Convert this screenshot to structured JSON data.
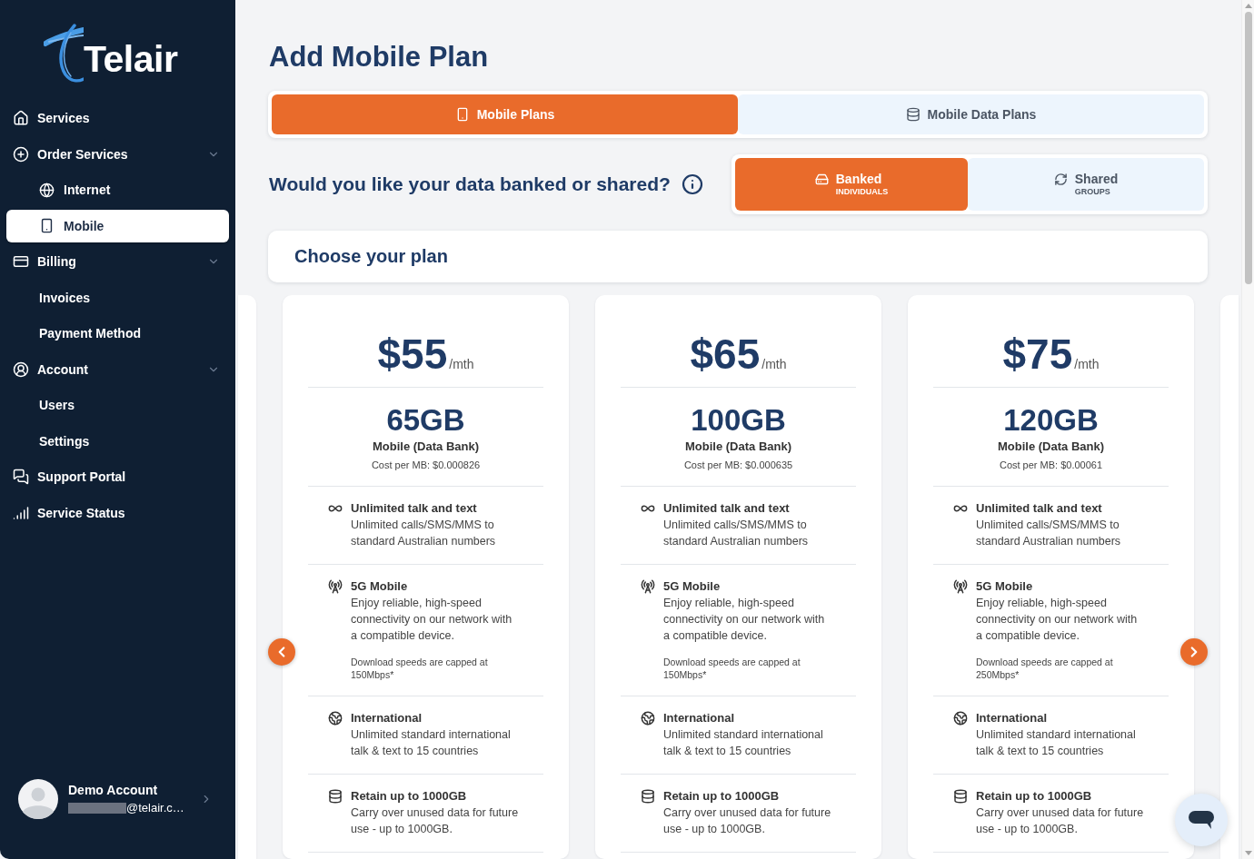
{
  "sidebar": {
    "logo": "Telair",
    "nav": [
      {
        "label": "Services",
        "selected": false
      },
      {
        "label": "Order Services",
        "selected": false,
        "expanded": true,
        "children": [
          {
            "label": "Internet",
            "selected": false
          },
          {
            "label": "Mobile",
            "selected": true
          }
        ]
      },
      {
        "label": "Billing",
        "selected": false,
        "expanded": true,
        "children": [
          {
            "label": "Invoices",
            "selected": false
          },
          {
            "label": "Payment Method",
            "selected": false
          }
        ]
      },
      {
        "label": "Account",
        "selected": false,
        "expanded": true,
        "children": [
          {
            "label": "Users",
            "selected": false
          },
          {
            "label": "Settings",
            "selected": false
          }
        ]
      },
      {
        "label": "Support Portal",
        "selected": false
      },
      {
        "label": "Service Status",
        "selected": false
      }
    ],
    "user": {
      "name": "Demo Account",
      "email": "@telair.c…"
    }
  },
  "page": {
    "title": "Add Mobile Plan"
  },
  "tabs": [
    {
      "label": "Mobile Plans",
      "selected": true
    },
    {
      "label": "Mobile Data Plans",
      "selected": false
    }
  ],
  "data_mode": {
    "question": "Would you like your data banked or shared?",
    "options": [
      {
        "label": "Banked",
        "sublabel": "INDIVIDUALS",
        "selected": true
      },
      {
        "label": "Shared",
        "sublabel": "GROUPS",
        "selected": false
      }
    ]
  },
  "plans_section": {
    "title": "Choose your plan",
    "plans": [
      {
        "price": "$55",
        "period": "/mth",
        "data": "65GB",
        "type": "Mobile (Data Bank)",
        "cost_per_mb": "Cost per MB: $0.000826",
        "features": [
          {
            "title": "Unlimited talk and text",
            "description": "Unlimited calls/SMS/MMS to standard Australian numbers"
          },
          {
            "title": "5G Mobile",
            "description": "Enjoy reliable, high-speed connectivity on our network with a compatible device.",
            "note": "Download speeds are capped at 150Mbps*"
          },
          {
            "title": "International",
            "description": "Unlimited standard international talk & text to 15 countries"
          },
          {
            "title": "Retain up to 1000GB",
            "description": "Carry over unused data for future use - up to 1000GB."
          }
        ]
      },
      {
        "price": "$65",
        "period": "/mth",
        "data": "100GB",
        "type": "Mobile (Data Bank)",
        "cost_per_mb": "Cost per MB: $0.000635",
        "features": [
          {
            "title": "Unlimited talk and text",
            "description": "Unlimited calls/SMS/MMS to standard Australian numbers"
          },
          {
            "title": "5G Mobile",
            "description": "Enjoy reliable, high-speed connectivity on our network with a compatible device.",
            "note": "Download speeds are capped at 150Mbps*"
          },
          {
            "title": "International",
            "description": "Unlimited standard international talk & text to 15 countries"
          },
          {
            "title": "Retain up to 1000GB",
            "description": "Carry over unused data for future use - up to 1000GB."
          }
        ]
      },
      {
        "price": "$75",
        "period": "/mth",
        "data": "120GB",
        "type": "Mobile (Data Bank)",
        "cost_per_mb": "Cost per MB: $0.00061",
        "features": [
          {
            "title": "Unlimited talk and text",
            "description": "Unlimited calls/SMS/MMS to standard Australian numbers"
          },
          {
            "title": "5G Mobile",
            "description": "Enjoy reliable, high-speed connectivity on our network with a compatible device.",
            "note": "Download speeds are capped at 250Mbps*"
          },
          {
            "title": "International",
            "description": "Unlimited standard international talk & text to 15 countries"
          },
          {
            "title": "Retain up to 1000GB",
            "description": "Carry over unused data for future use - up to 1000GB."
          }
        ]
      }
    ]
  }
}
